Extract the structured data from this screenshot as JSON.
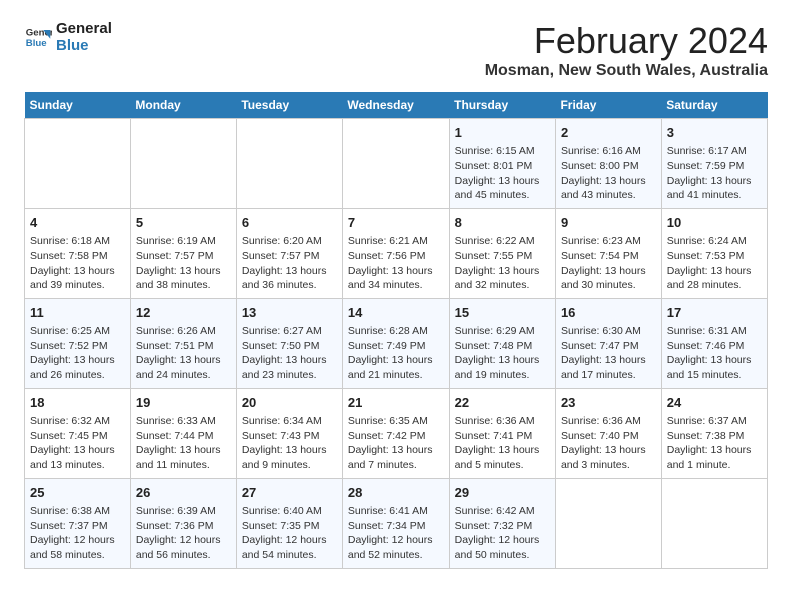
{
  "header": {
    "logo_line1": "General",
    "logo_line2": "Blue",
    "title": "February 2024",
    "subtitle": "Mosman, New South Wales, Australia"
  },
  "calendar": {
    "days_of_week": [
      "Sunday",
      "Monday",
      "Tuesday",
      "Wednesday",
      "Thursday",
      "Friday",
      "Saturday"
    ],
    "weeks": [
      [
        {
          "day": "",
          "content": ""
        },
        {
          "day": "",
          "content": ""
        },
        {
          "day": "",
          "content": ""
        },
        {
          "day": "",
          "content": ""
        },
        {
          "day": "1",
          "content": "Sunrise: 6:15 AM\nSunset: 8:01 PM\nDaylight: 13 hours\nand 45 minutes."
        },
        {
          "day": "2",
          "content": "Sunrise: 6:16 AM\nSunset: 8:00 PM\nDaylight: 13 hours\nand 43 minutes."
        },
        {
          "day": "3",
          "content": "Sunrise: 6:17 AM\nSunset: 7:59 PM\nDaylight: 13 hours\nand 41 minutes."
        }
      ],
      [
        {
          "day": "4",
          "content": "Sunrise: 6:18 AM\nSunset: 7:58 PM\nDaylight: 13 hours\nand 39 minutes."
        },
        {
          "day": "5",
          "content": "Sunrise: 6:19 AM\nSunset: 7:57 PM\nDaylight: 13 hours\nand 38 minutes."
        },
        {
          "day": "6",
          "content": "Sunrise: 6:20 AM\nSunset: 7:57 PM\nDaylight: 13 hours\nand 36 minutes."
        },
        {
          "day": "7",
          "content": "Sunrise: 6:21 AM\nSunset: 7:56 PM\nDaylight: 13 hours\nand 34 minutes."
        },
        {
          "day": "8",
          "content": "Sunrise: 6:22 AM\nSunset: 7:55 PM\nDaylight: 13 hours\nand 32 minutes."
        },
        {
          "day": "9",
          "content": "Sunrise: 6:23 AM\nSunset: 7:54 PM\nDaylight: 13 hours\nand 30 minutes."
        },
        {
          "day": "10",
          "content": "Sunrise: 6:24 AM\nSunset: 7:53 PM\nDaylight: 13 hours\nand 28 minutes."
        }
      ],
      [
        {
          "day": "11",
          "content": "Sunrise: 6:25 AM\nSunset: 7:52 PM\nDaylight: 13 hours\nand 26 minutes."
        },
        {
          "day": "12",
          "content": "Sunrise: 6:26 AM\nSunset: 7:51 PM\nDaylight: 13 hours\nand 24 minutes."
        },
        {
          "day": "13",
          "content": "Sunrise: 6:27 AM\nSunset: 7:50 PM\nDaylight: 13 hours\nand 23 minutes."
        },
        {
          "day": "14",
          "content": "Sunrise: 6:28 AM\nSunset: 7:49 PM\nDaylight: 13 hours\nand 21 minutes."
        },
        {
          "day": "15",
          "content": "Sunrise: 6:29 AM\nSunset: 7:48 PM\nDaylight: 13 hours\nand 19 minutes."
        },
        {
          "day": "16",
          "content": "Sunrise: 6:30 AM\nSunset: 7:47 PM\nDaylight: 13 hours\nand 17 minutes."
        },
        {
          "day": "17",
          "content": "Sunrise: 6:31 AM\nSunset: 7:46 PM\nDaylight: 13 hours\nand 15 minutes."
        }
      ],
      [
        {
          "day": "18",
          "content": "Sunrise: 6:32 AM\nSunset: 7:45 PM\nDaylight: 13 hours\nand 13 minutes."
        },
        {
          "day": "19",
          "content": "Sunrise: 6:33 AM\nSunset: 7:44 PM\nDaylight: 13 hours\nand 11 minutes."
        },
        {
          "day": "20",
          "content": "Sunrise: 6:34 AM\nSunset: 7:43 PM\nDaylight: 13 hours\nand 9 minutes."
        },
        {
          "day": "21",
          "content": "Sunrise: 6:35 AM\nSunset: 7:42 PM\nDaylight: 13 hours\nand 7 minutes."
        },
        {
          "day": "22",
          "content": "Sunrise: 6:36 AM\nSunset: 7:41 PM\nDaylight: 13 hours\nand 5 minutes."
        },
        {
          "day": "23",
          "content": "Sunrise: 6:36 AM\nSunset: 7:40 PM\nDaylight: 13 hours\nand 3 minutes."
        },
        {
          "day": "24",
          "content": "Sunrise: 6:37 AM\nSunset: 7:38 PM\nDaylight: 13 hours\nand 1 minute."
        }
      ],
      [
        {
          "day": "25",
          "content": "Sunrise: 6:38 AM\nSunset: 7:37 PM\nDaylight: 12 hours\nand 58 minutes."
        },
        {
          "day": "26",
          "content": "Sunrise: 6:39 AM\nSunset: 7:36 PM\nDaylight: 12 hours\nand 56 minutes."
        },
        {
          "day": "27",
          "content": "Sunrise: 6:40 AM\nSunset: 7:35 PM\nDaylight: 12 hours\nand 54 minutes."
        },
        {
          "day": "28",
          "content": "Sunrise: 6:41 AM\nSunset: 7:34 PM\nDaylight: 12 hours\nand 52 minutes."
        },
        {
          "day": "29",
          "content": "Sunrise: 6:42 AM\nSunset: 7:32 PM\nDaylight: 12 hours\nand 50 minutes."
        },
        {
          "day": "",
          "content": ""
        },
        {
          "day": "",
          "content": ""
        }
      ]
    ]
  }
}
